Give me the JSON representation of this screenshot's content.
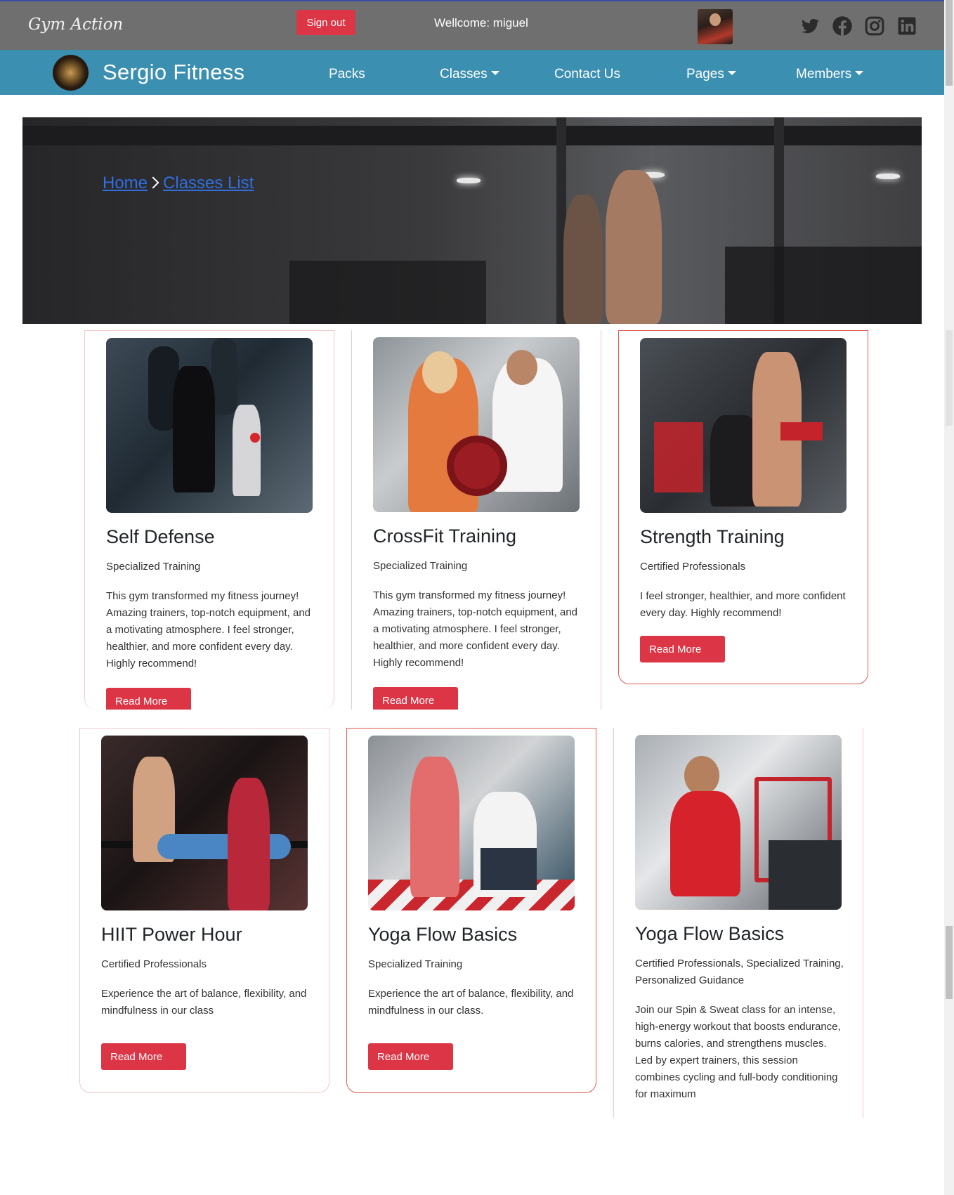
{
  "topbar": {
    "brand": "Gym Action",
    "signout_label": "Sign out",
    "welcome": "Wellcome: miguel"
  },
  "nav": {
    "brand": "Sergio Fitness",
    "links": [
      "Packs",
      "Classes",
      "Contact Us",
      "Pages",
      "Members"
    ]
  },
  "hero": {
    "breadcrumb": [
      "Home",
      "Classes List"
    ]
  },
  "classes": [
    {
      "title": "Self Defense",
      "subtitle": "Specialized Training",
      "description": "This gym transformed my fitness journey! Amazing trainers, top-notch equipment, and a motivating atmosphere. I feel stronger, healthier, and more confident every day. Highly recommend!",
      "button": "Read More"
    },
    {
      "title": "CrossFit Training",
      "subtitle": "Specialized Training",
      "description": "This gym transformed my fitness journey! Amazing trainers, top-notch equipment, and a motivating atmosphere. I feel stronger, healthier, and more confident every day. Highly recommend!",
      "button": "Read More"
    },
    {
      "title": "Strength Training",
      "subtitle": "Certified Professionals",
      "description": "I feel stronger, healthier, and more confident every day. Highly recommend!",
      "button": "Read More"
    },
    {
      "title": "HIIT Power Hour",
      "subtitle": "Certified Professionals",
      "description": "Experience the art of balance, flexibility, and mindfulness in our class",
      "button": "Read More"
    },
    {
      "title": "Yoga Flow Basics",
      "subtitle": "Specialized Training",
      "description": "Experience the art of balance, flexibility, and mindfulness in our class.",
      "button": "Read More"
    },
    {
      "title": "Yoga Flow Basics",
      "subtitle": "Certified Professionals, Specialized Training, Personalized Guidance",
      "description": "Join our Spin & Sweat class for an intense, high-energy workout that boosts endurance, burns calories, and strengthens muscles. Led by expert trainers, this session combines cycling and full-body conditioning for maximum",
      "button": "Read More"
    }
  ],
  "colors": {
    "topbar": "#6f6f6f",
    "navbar": "#3b8fb0",
    "accent": "#dc3545",
    "card_border": "#e25a4f"
  },
  "icons": [
    "twitter-icon",
    "facebook-icon",
    "instagram-icon",
    "linkedin-icon"
  ]
}
